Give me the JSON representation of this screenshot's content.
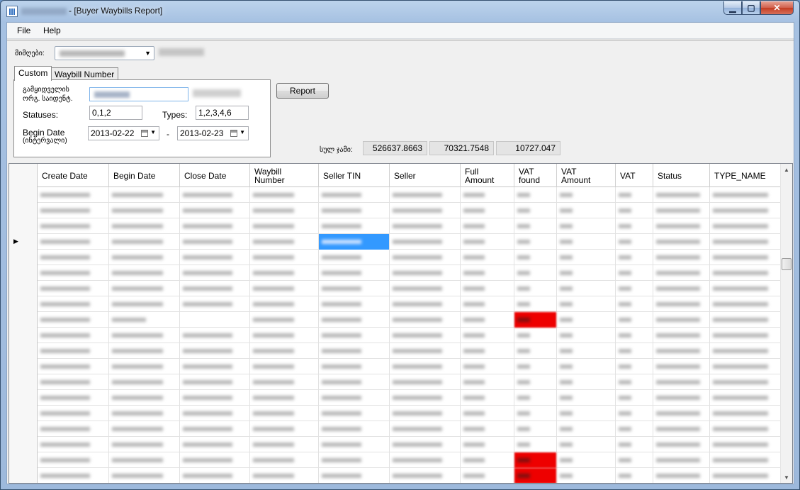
{
  "window": {
    "title": "- [Buyer Waybills Report]"
  },
  "menu": {
    "file": "File",
    "help": "Help"
  },
  "filter": {
    "receiver_label": "მიმღები:",
    "tabs": [
      "Custom",
      "Waybill Number"
    ],
    "supplier_label_line1": "გამყიდველის",
    "supplier_label_line2": "ორგ. საიდენტ.",
    "statuses_label": "Statuses:",
    "statuses_value": "0,1,2",
    "types_label": "Types:",
    "types_value": "1,2,3,4,6",
    "begin_date_label": "Begin Date",
    "begin_date_sublabel": "(ინტერვალი)",
    "begin_date_from": "2013-02-22",
    "date_separator": "-",
    "begin_date_to": "2013-02-23"
  },
  "report_button": "Report",
  "totals": {
    "label": "სულ ჯამი:",
    "full_amount": "526637.8663",
    "vat_amount": "70321.7548",
    "vat": "10727.047"
  },
  "grid": {
    "columns": [
      "Create Date",
      "Begin Date",
      "Close Date",
      "Waybill\nNumber",
      "Seller TIN",
      "Seller",
      "Full\nAmount",
      "VAT\nfound",
      "VAT\nAmount",
      "VAT",
      "Status",
      "TYPE_NAME"
    ],
    "row_count": 19,
    "current_row": 3,
    "selected_cell": {
      "row": 3,
      "col": 4
    },
    "highlighted_cells": [
      {
        "row": 8,
        "col": 7
      },
      {
        "row": 17,
        "col": 7
      },
      {
        "row": 18,
        "col": 7
      }
    ],
    "colors": {
      "selection": "#3399ff",
      "highlight": "#ee0000"
    }
  }
}
